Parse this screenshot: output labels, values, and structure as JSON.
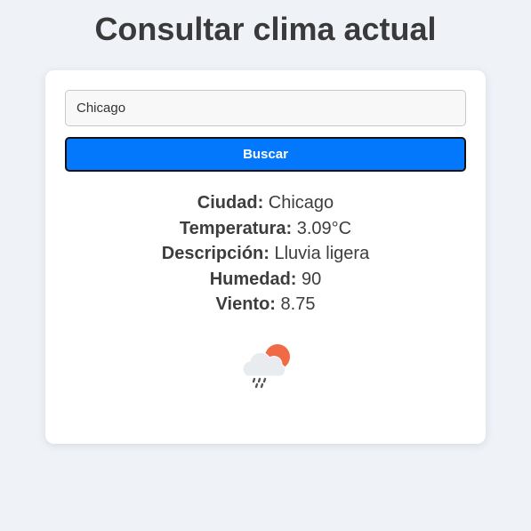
{
  "page": {
    "title": "Consultar clima actual"
  },
  "search": {
    "value": "Chicago",
    "button_label": "Buscar"
  },
  "weather": {
    "city_label": "Ciudad:",
    "city": "Chicago",
    "temp_label": "Temperatura:",
    "temp": "3.09°C",
    "desc_label": "Descripción:",
    "desc": "Lluvia ligera",
    "humidity_label": "Humedad:",
    "humidity": "90",
    "wind_label": "Viento:",
    "wind": "8.75",
    "icon": "light-rain-cloud-sun-icon"
  },
  "colors": {
    "background": "#eff3f8",
    "card": "#ffffff",
    "button": "#0478fd",
    "sun": "#ef6a45"
  }
}
